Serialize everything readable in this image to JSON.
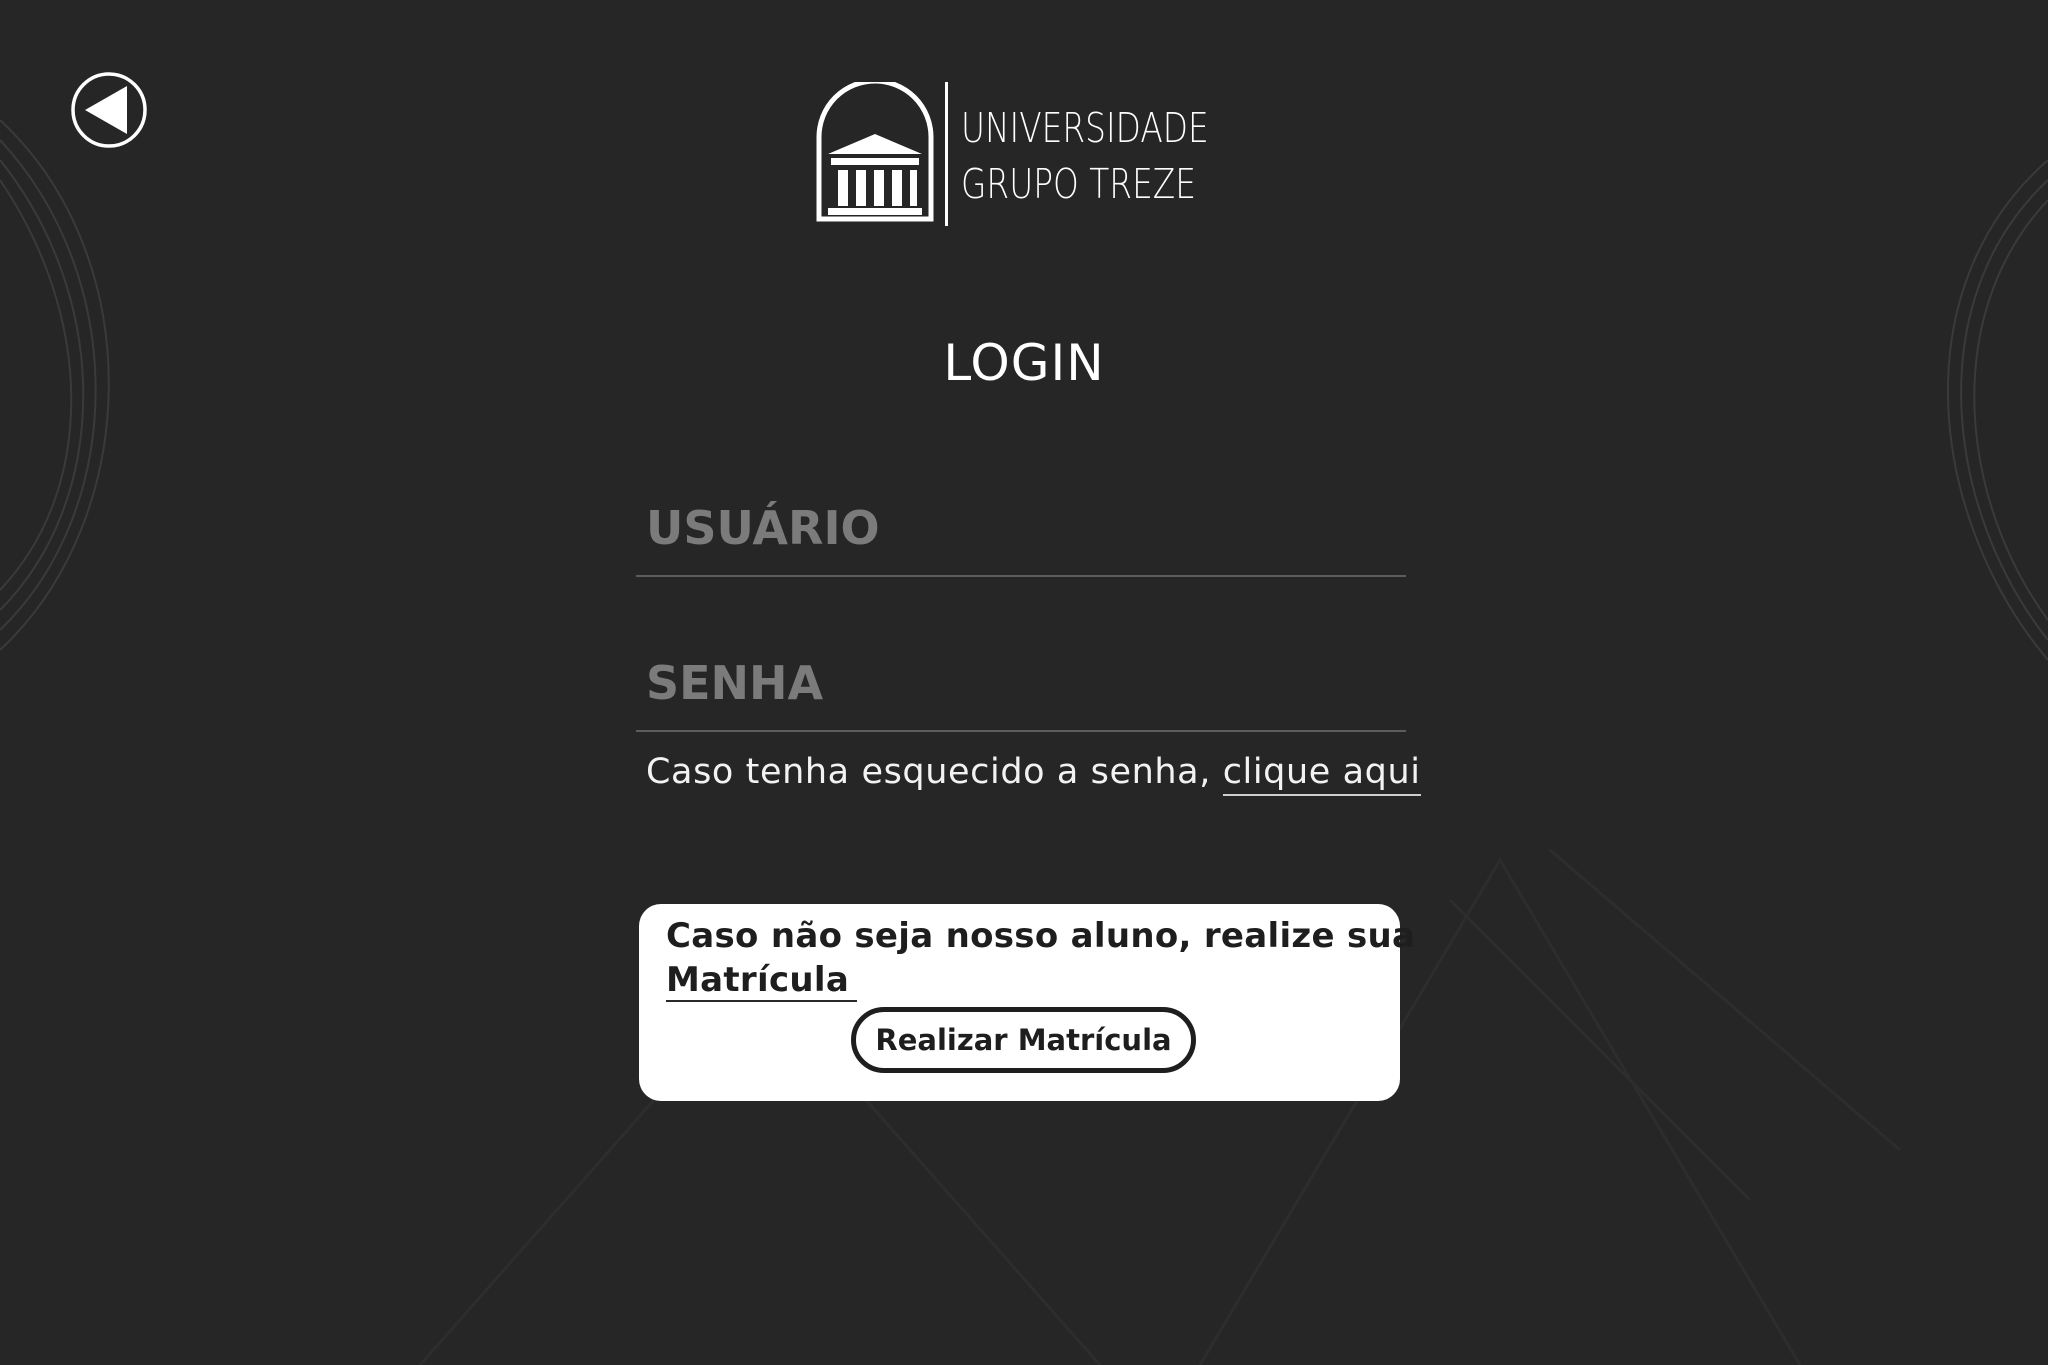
{
  "back_button": {
    "icon": "back-arrow-icon"
  },
  "logo": {
    "icon": "university-building-icon",
    "line1": "UNIVERSIDADE",
    "line2": "GRUPO TREZE"
  },
  "login": {
    "title": "LOGIN",
    "username": {
      "placeholder": "USUÁRIO",
      "value": ""
    },
    "password": {
      "placeholder": "SENHA",
      "value": ""
    },
    "forgot_text": "Caso tenha esquecido a senha, ",
    "forgot_link": "clique aqui"
  },
  "enroll": {
    "text_line1": "Caso não seja nosso aluno, realize sua",
    "text_line2": "Matrícula",
    "button_label": "Realizar Matrícula"
  },
  "colors": {
    "background": "#262626",
    "text": "#ffffff",
    "placeholder": "#7b7b7b",
    "card": "#ffffff",
    "card_text": "#1e1e1e"
  }
}
